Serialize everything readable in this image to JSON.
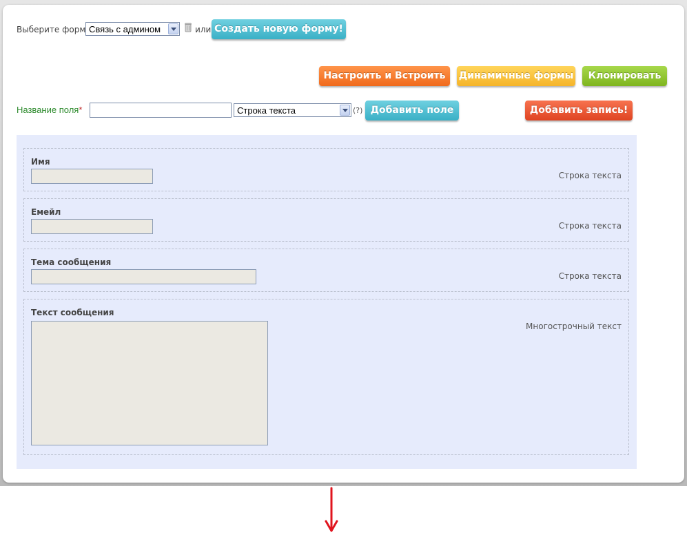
{
  "top": {
    "choose_form_label": "Выберите форму",
    "selected_form": "Связь с админом",
    "or_label": "или",
    "create_form_button": "Создать новую форму!"
  },
  "actions": {
    "configure_button": "Настроить и Встроить",
    "dynamic_button": "Динамичные формы",
    "clone_button": "Клонировать"
  },
  "add_field": {
    "label": "Название поля",
    "required_mark": "*",
    "name_value": "",
    "type_selected": "Строка текста",
    "help": "(?)",
    "add_field_button": "Добавить поле",
    "add_record_button": "Добавить запись!"
  },
  "fields": [
    {
      "label": "Имя",
      "type": "Строка текста"
    },
    {
      "label": "Емейл",
      "type": "Строка текста"
    },
    {
      "label": "Тема сообщения",
      "type": "Строка текста"
    },
    {
      "label": "Текст сообщения",
      "type": "Многострочный текст"
    }
  ],
  "colors": {
    "teal": "#3ab0c6",
    "orange": "#f06a1c",
    "yellow": "#f5b42a",
    "green": "#7fb51f",
    "red": "#df4422",
    "form_background": "#e6ebfc",
    "arrow": "#e0141e"
  },
  "icons": {
    "delete": "trash-icon",
    "arrow": "arrow-down-icon"
  }
}
